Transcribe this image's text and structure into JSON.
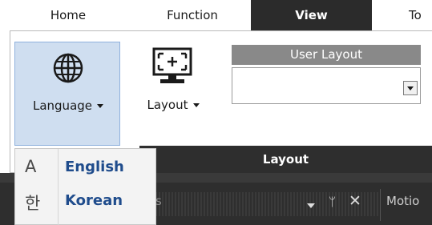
{
  "tabs": [
    {
      "label": "Home"
    },
    {
      "label": "Function"
    },
    {
      "label": "View",
      "active": true
    },
    {
      "label": "To"
    }
  ],
  "ribbon": {
    "language_button": {
      "label": "Language",
      "icon": "globe-icon"
    },
    "layout_button": {
      "label": "Layout",
      "icon": "monitor-layout-icon"
    },
    "user_layout": {
      "header": "User Layout",
      "value": ""
    },
    "group_label": "Layout"
  },
  "language_menu": {
    "items": [
      {
        "icon_glyph": "A",
        "label": "English"
      },
      {
        "icon_glyph": "한",
        "label": "Korean"
      }
    ]
  },
  "dock": {
    "title": "s",
    "pin_glyph": "ᛘ",
    "close_glyph": "✕",
    "motion_tab": "Motio"
  },
  "colors": {
    "active_tab_bg": "#2b2b2b",
    "language_button_bg": "#cfdef0",
    "menu_text": "#1f4c8c",
    "footer_bg": "#2e2e2e"
  }
}
